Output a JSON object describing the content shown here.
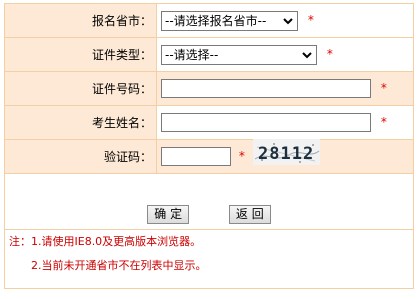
{
  "form": {
    "province": {
      "label": "报名省市：",
      "value": "--请选择报名省市--"
    },
    "id_type": {
      "label": "证件类型：",
      "value": "--请选择--"
    },
    "id_number": {
      "label": "证件号码：",
      "value": ""
    },
    "name": {
      "label": "考生姓名：",
      "value": ""
    },
    "captcha": {
      "label": "验证码：",
      "value": "",
      "image_text": "28112"
    },
    "required_mark": "*"
  },
  "buttons": {
    "confirm": "确 定",
    "back": "返 回"
  },
  "notes": {
    "line1": "注：1.请使用IE8.0及更高版本浏览器。",
    "line2": "2.当前未开通省市不在列表中显示。"
  },
  "colors": {
    "label_bg": "#fde9d6",
    "border": "#f5cfa4",
    "required": "#e00000",
    "note": "#cc0000"
  }
}
